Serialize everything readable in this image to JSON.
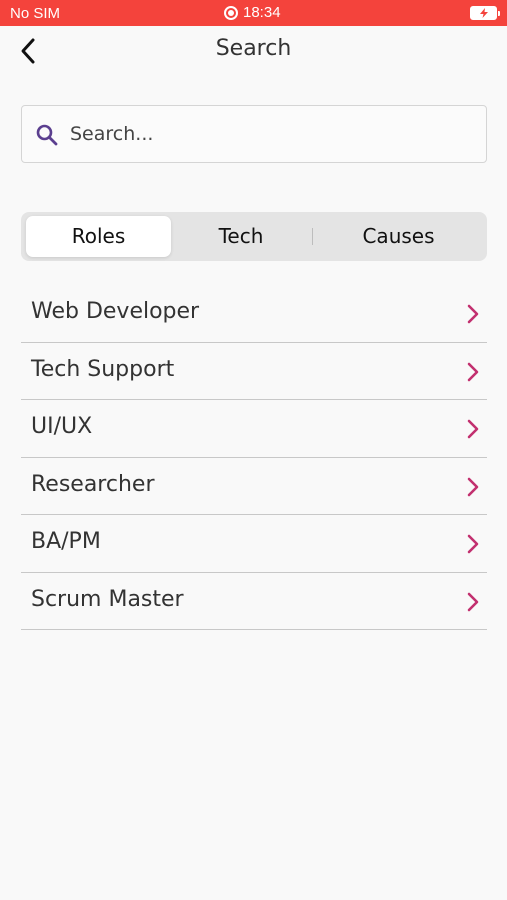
{
  "status_bar": {
    "carrier": "No SIM",
    "time": "18:34"
  },
  "nav": {
    "title": "Search"
  },
  "search": {
    "placeholder": "Search..."
  },
  "tabs": [
    {
      "label": "Roles",
      "selected": true
    },
    {
      "label": "Tech",
      "selected": false
    },
    {
      "label": "Causes",
      "selected": false
    }
  ],
  "roles": [
    {
      "label": "Web Developer"
    },
    {
      "label": "Tech Support"
    },
    {
      "label": "UI/UX"
    },
    {
      "label": "Researcher"
    },
    {
      "label": "BA/PM"
    },
    {
      "label": "Scrum Master"
    }
  ],
  "colors": {
    "status_bar": "#f4433c",
    "accent_chevron": "#c2306f",
    "search_icon": "#5b3f8f"
  },
  "icons": {
    "back": "chevron-left-icon",
    "search": "search-icon",
    "row": "chevron-right-icon",
    "battery": "battery-charging-icon",
    "record": "record-icon"
  }
}
